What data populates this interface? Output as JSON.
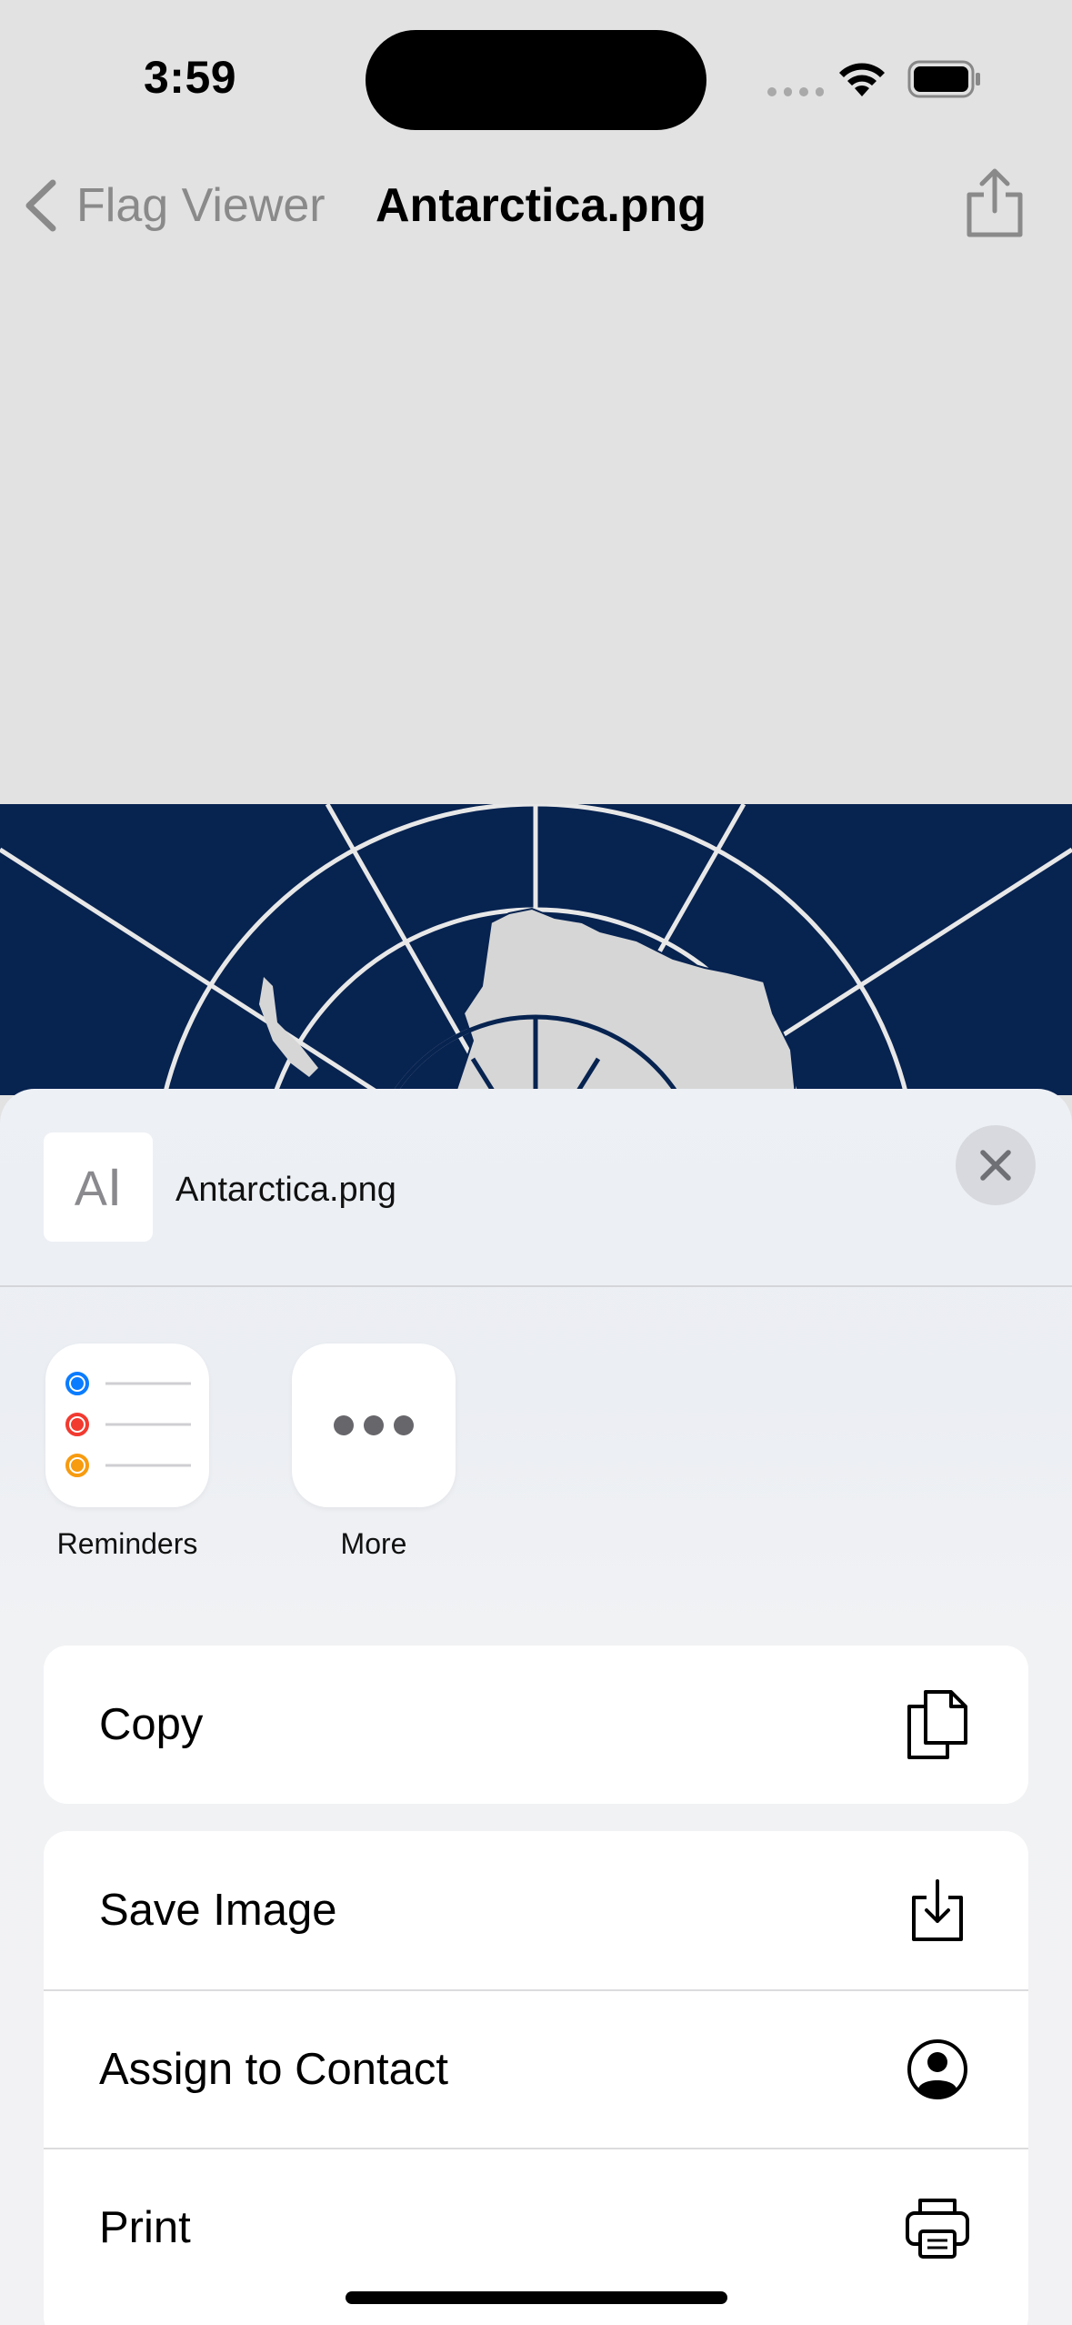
{
  "status_bar": {
    "time": "3:59"
  },
  "nav": {
    "back_label": "Flag Viewer",
    "title": "Antarctica.png"
  },
  "share_sheet": {
    "file_thumb_glyph": "A",
    "file_name": "Antarctica.png",
    "apps": [
      {
        "label": "Reminders",
        "icon": "reminders-icon"
      },
      {
        "label": "More",
        "icon": "more-icon"
      }
    ],
    "actions": [
      {
        "label": "Copy",
        "icon": "copy-icon"
      },
      {
        "label": "Save Image",
        "icon": "save-image-icon"
      },
      {
        "label": "Assign to Contact",
        "icon": "person-circle-icon"
      },
      {
        "label": "Print",
        "icon": "printer-icon"
      }
    ]
  },
  "colors": {
    "flag_blue": "#072350",
    "reminder_blue": "#0a7cff",
    "reminder_red": "#f23a30",
    "reminder_orange": "#f79b0f"
  }
}
